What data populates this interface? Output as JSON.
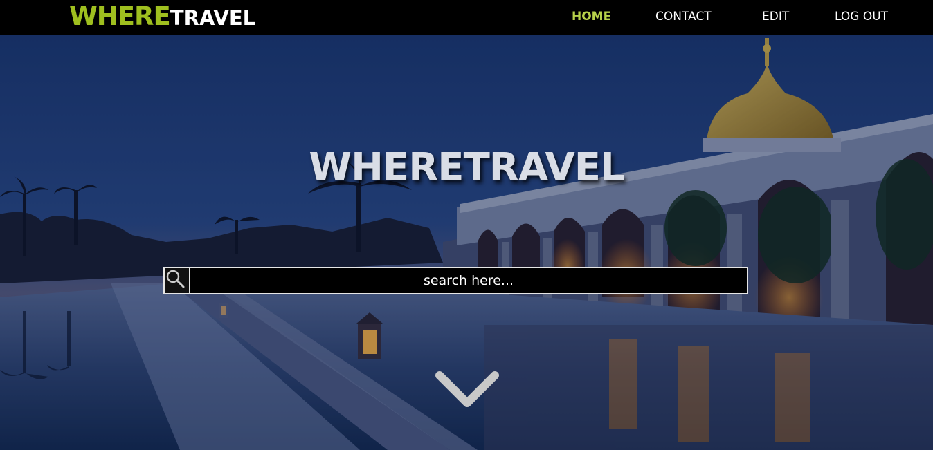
{
  "header": {
    "logo": {
      "part1": "WHERE",
      "part2": "TRAVEL"
    },
    "nav": [
      {
        "label": "HOME",
        "active": true
      },
      {
        "label": "CONTACT",
        "active": false
      },
      {
        "label": "EDIT",
        "active": false
      },
      {
        "label": "LOG OUT",
        "active": false
      }
    ]
  },
  "hero": {
    "title": "WHERETRAVEL",
    "search": {
      "placeholder": "search here...",
      "value": "",
      "icon": "magnifier-icon"
    },
    "scroll_icon": "chevron-down-icon"
  },
  "colors": {
    "accent": "#9fbf1f",
    "nav_active": "#b7d14a",
    "nav_bg": "#000000"
  }
}
